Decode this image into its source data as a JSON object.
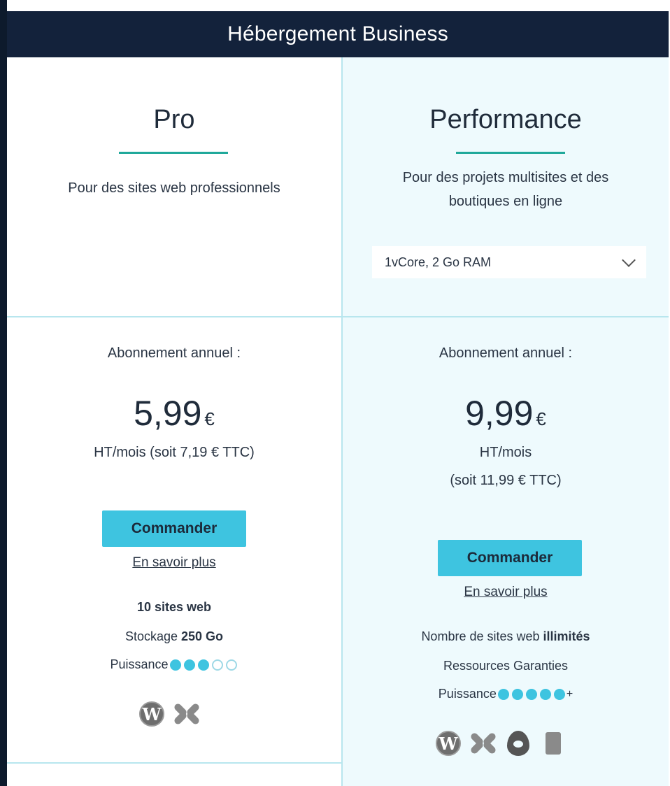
{
  "header": {
    "title": "Hébergement Business"
  },
  "plans": [
    {
      "name": "Pro",
      "description_lines": [
        "Pour des sites web professionnels"
      ],
      "subscription_label": "Abonnement annuel :",
      "price_value": "5,99",
      "price_currency": "€",
      "price_detail_lines": [
        "HT/mois (soit 7,19 € TTC)"
      ],
      "order_label": "Commander",
      "more_label": "En savoir plus",
      "features": [
        {
          "prefix": "",
          "bold": "10 sites web",
          "suffix": ""
        },
        {
          "prefix": "Stockage ",
          "bold": "250 Go",
          "suffix": ""
        }
      ],
      "power_label": "Puissance",
      "power_level": 3,
      "power_max": 5,
      "power_plus": "",
      "cms_icons": [
        "wordpress-icon",
        "joomla-icon"
      ]
    },
    {
      "name": "Performance",
      "description_lines": [
        "Pour des projets multisites et des",
        "boutiques en ligne"
      ],
      "select_value": "1vCore, 2 Go RAM",
      "subscription_label": "Abonnement annuel :",
      "price_value": "9,99",
      "price_currency": "€",
      "price_detail_lines": [
        "HT/mois",
        "(soit 11,99 € TTC)"
      ],
      "order_label": "Commander",
      "more_label": "En savoir plus",
      "features": [
        {
          "prefix": "Nombre de sites web ",
          "bold": "illimités",
          "suffix": ""
        },
        {
          "prefix": "Ressources Garanties",
          "bold": "",
          "suffix": ""
        }
      ],
      "power_label": "Puissance",
      "power_level": 5,
      "power_max": 5,
      "power_plus": "+",
      "cms_icons": [
        "wordpress-icon",
        "joomla-icon",
        "drupal-icon",
        "other-cms-icon"
      ]
    }
  ],
  "colors": {
    "header_bg": "#13223b",
    "accent": "#3ec4e0",
    "underline": "#1fa89a",
    "perf_bg": "#eefafd"
  }
}
